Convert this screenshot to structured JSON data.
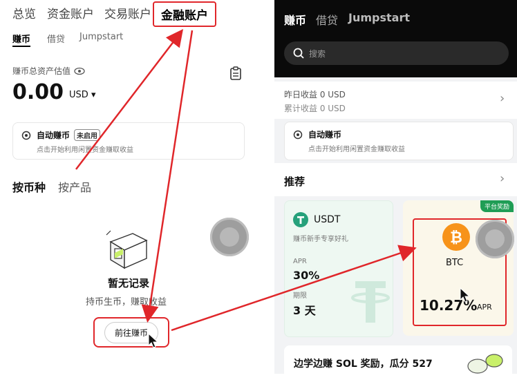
{
  "left": {
    "top_tabs": [
      "总览",
      "资金账户",
      "交易账户",
      "金融账户"
    ],
    "sub_tabs": [
      "赚币",
      "借贷",
      "Jumpstart"
    ],
    "asset_label": "赚币总资产估值",
    "asset_value": "0.00",
    "currency": "USD",
    "auto_earn": {
      "title": "自动赚币",
      "badge": "未启用",
      "desc": "点击开始利用闲置资金赚取收益"
    },
    "filter_tabs": [
      "按币种",
      "按产品"
    ],
    "empty": {
      "title": "暂无记录",
      "desc": "持币生币，赚取收益"
    },
    "go_button": "前往赚币"
  },
  "right": {
    "top_tabs": [
      "赚币",
      "借贷",
      "Jumpstart"
    ],
    "search_placeholder": "搜索",
    "yesterday": "昨日收益 0 USD",
    "total": "累计收益 0 USD",
    "auto_earn": {
      "title": "自动赚币",
      "desc": "点击开始利用闲置资金赚取收益"
    },
    "recommend_label": "推荐",
    "usdt": {
      "name": "USDT",
      "desc": "赚币新手专享好礼",
      "apr_label": "APR",
      "apr_value": "30%",
      "term_label": "期限",
      "term_value": "3 天"
    },
    "btc": {
      "badge": "平台奖励",
      "name": "BTC",
      "apr_value": "10.27%",
      "apr_label": "APR"
    },
    "banner": "边学边赚 SOL 奖励，瓜分 527"
  },
  "colors": {
    "highlight": "#e0262a",
    "usdt": "#26a17b",
    "btc": "#f7931a",
    "dark_header": "#0a0a0a"
  }
}
